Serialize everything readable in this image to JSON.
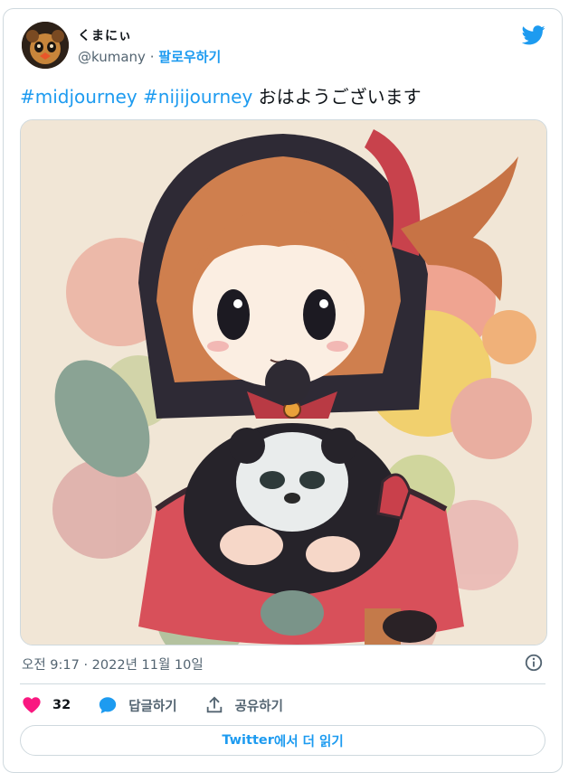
{
  "author": {
    "display_name": "くまにぃ",
    "handle": "@kumany",
    "separator": "·",
    "follow_label": "팔로우하기"
  },
  "tweet": {
    "hashtags": [
      "#midjourney",
      "#nijijourney"
    ],
    "text": "おはようございます"
  },
  "meta": {
    "timestamp": "오전 9:17 · 2022년 11월 10일"
  },
  "actions": {
    "like_count": "32",
    "reply_label": "답글하기",
    "share_label": "공유하기"
  },
  "footer": {
    "read_more_brand": "Twitter",
    "read_more_suffix": "에서 더 읽기"
  },
  "colors": {
    "accent": "#1d9bf0",
    "like": "#f91880",
    "muted": "#536471",
    "border": "#cfd9de"
  },
  "icons": [
    "twitter-bird-icon",
    "info-icon",
    "heart-icon",
    "reply-bubble-icon",
    "share-icon"
  ]
}
